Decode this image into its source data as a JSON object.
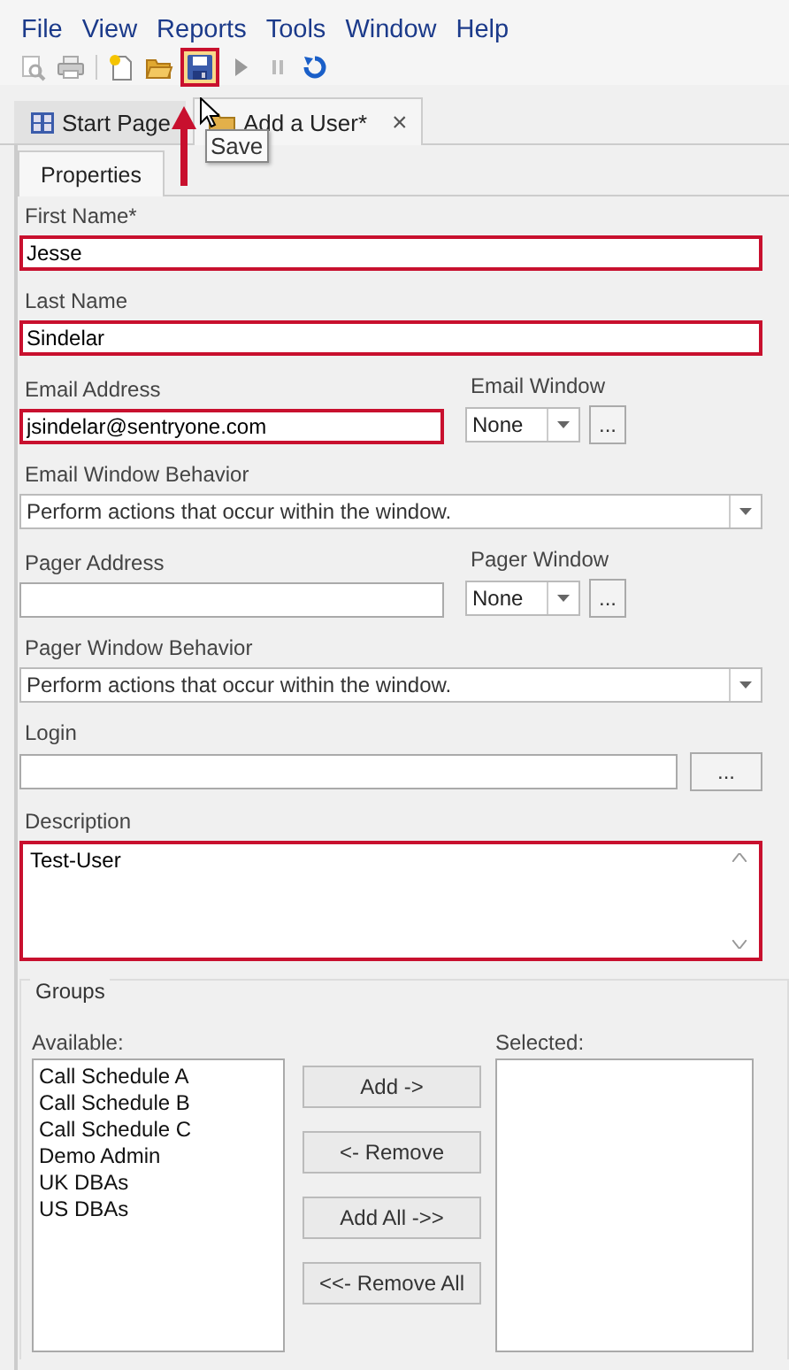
{
  "menu": [
    "File",
    "View",
    "Reports",
    "Tools",
    "Window",
    "Help"
  ],
  "toolbar": [
    {
      "kind": "preview",
      "highlighted": false
    },
    {
      "kind": "print",
      "highlighted": false
    },
    {
      "kind": "new",
      "highlighted": false
    },
    {
      "kind": "open",
      "highlighted": false
    },
    {
      "kind": "save",
      "highlighted": true
    },
    {
      "kind": "play",
      "highlighted": false
    },
    {
      "kind": "pause",
      "highlighted": false
    },
    {
      "kind": "refresh",
      "highlighted": false
    }
  ],
  "tooltip": "Save",
  "document_tabs": [
    {
      "label": "Start Page",
      "selected": false,
      "kind": "start"
    },
    {
      "label": "Add a User*",
      "selected": true,
      "kind": "folder",
      "close": "×"
    }
  ],
  "panel_tabs": [
    {
      "label": "Properties",
      "selected": true
    }
  ],
  "form": [
    {
      "kind": "text",
      "label": "First Name*",
      "value": "Jesse",
      "highlighted": true
    },
    {
      "kind": "text",
      "label": "Last Name",
      "value": "Sindelar",
      "highlighted": true
    },
    {
      "kind": "text_combo",
      "label": "Email Address",
      "value": "jsindelar@sentryone.com",
      "highlighted": true,
      "combo_label": "Email Window",
      "combo_value": "None",
      "button": "..."
    },
    {
      "kind": "select",
      "label": "Email Window Behavior",
      "value": "Perform actions that occur within the window."
    },
    {
      "kind": "text_combo",
      "label": "Pager Address",
      "highlighted": false,
      "combo_label": "Pager Window",
      "combo_value": "None",
      "button": "..."
    },
    {
      "kind": "select",
      "label": "Pager Window Behavior",
      "value": "Perform actions that occur within the window."
    },
    {
      "kind": "browse",
      "label": "Login",
      "highlighted": false,
      "button": "..."
    },
    {
      "kind": "textarea",
      "label": "Description",
      "value": "Test-User",
      "highlighted": true
    }
  ],
  "groups": {
    "title": "Groups",
    "available_label": "Available:",
    "available": [
      "Call Schedule A",
      "Call Schedule B",
      "Call Schedule C",
      "Demo Admin",
      "UK DBAs",
      "US DBAs"
    ],
    "buttons": [
      "Add ->",
      "<- Remove",
      "Add All ->>",
      "<<- Remove All"
    ],
    "selected_label": "Selected:"
  }
}
